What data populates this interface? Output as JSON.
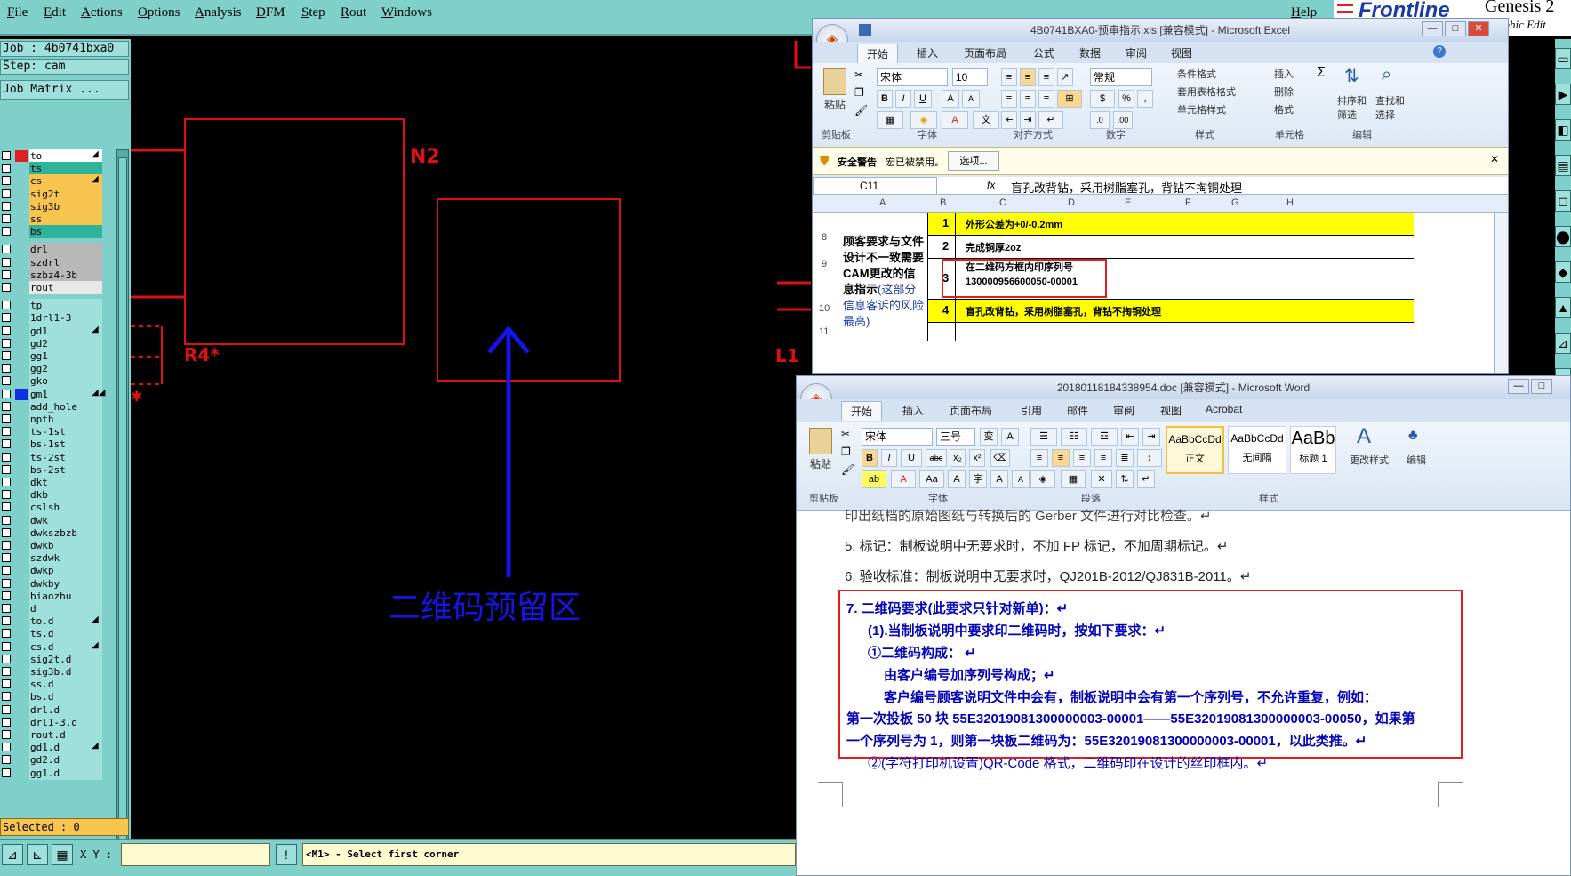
{
  "genesis": {
    "menu": [
      "File",
      "Edit",
      "Actions",
      "Options",
      "Analysis",
      "DFM",
      "Step",
      "Rout",
      "Windows"
    ],
    "help": "Help",
    "brand": "Frontline",
    "product": "Genesis 2",
    "product_sub": "raphic Edit",
    "job": "Job  : 4b0741bxa0",
    "step": "Step: cam",
    "matrix": "Job Matrix ...",
    "layers": [
      {
        "name": "to",
        "color": "#ffffff",
        "sw": "#e02020",
        "flag": "◢"
      },
      {
        "name": "ts",
        "color": "#2fb39a",
        "sw": "",
        "flag": ""
      },
      {
        "name": "cs",
        "color": "#f6c44f",
        "sw": "",
        "flag": "◢"
      },
      {
        "name": "sig2t",
        "color": "#f6c44f",
        "sw": "",
        "flag": ""
      },
      {
        "name": "sig3b",
        "color": "#f6c44f",
        "sw": "",
        "flag": ""
      },
      {
        "name": "ss",
        "color": "#f6c44f",
        "sw": "",
        "flag": ""
      },
      {
        "name": "bs",
        "color": "#2fb39a",
        "sw": "",
        "flag": ""
      },
      {
        "name": "",
        "color": "",
        "sw": "",
        "flag": ""
      },
      {
        "name": "drl",
        "color": "#b8b8b8",
        "sw": "",
        "flag": ""
      },
      {
        "name": "szdrl",
        "color": "#b8b8b8",
        "sw": "",
        "flag": ""
      },
      {
        "name": "szbz4-3b",
        "color": "#b8b8b8",
        "sw": "",
        "flag": ""
      },
      {
        "name": "rout",
        "color": "#e8e8e8",
        "sw": "",
        "flag": ""
      },
      {
        "name": "",
        "color": "",
        "sw": "",
        "flag": ""
      },
      {
        "name": "tp",
        "color": "#9fe0dc",
        "sw": "",
        "flag": ""
      },
      {
        "name": "1drl1-3",
        "color": "#9fe0dc",
        "sw": "",
        "flag": ""
      },
      {
        "name": "gd1",
        "color": "#9fe0dc",
        "sw": "",
        "flag": "◢"
      },
      {
        "name": "gd2",
        "color": "#9fe0dc",
        "sw": "",
        "flag": ""
      },
      {
        "name": "gg1",
        "color": "#9fe0dc",
        "sw": "",
        "flag": ""
      },
      {
        "name": "gg2",
        "color": "#9fe0dc",
        "sw": "",
        "flag": ""
      },
      {
        "name": "gko",
        "color": "#9fe0dc",
        "sw": "",
        "flag": ""
      },
      {
        "name": "gm1",
        "color": "#9fe0dc",
        "sw": "#1030e0",
        "flag": "◢◢"
      },
      {
        "name": "add_hole",
        "color": "#9fe0dc",
        "sw": "",
        "flag": ""
      },
      {
        "name": "npth",
        "color": "#9fe0dc",
        "sw": "",
        "flag": ""
      },
      {
        "name": "ts-1st",
        "color": "#9fe0dc",
        "sw": "",
        "flag": ""
      },
      {
        "name": "bs-1st",
        "color": "#9fe0dc",
        "sw": "",
        "flag": ""
      },
      {
        "name": "ts-2st",
        "color": "#9fe0dc",
        "sw": "",
        "flag": ""
      },
      {
        "name": "bs-2st",
        "color": "#9fe0dc",
        "sw": "",
        "flag": ""
      },
      {
        "name": "dkt",
        "color": "#9fe0dc",
        "sw": "",
        "flag": ""
      },
      {
        "name": "dkb",
        "color": "#9fe0dc",
        "sw": "",
        "flag": ""
      },
      {
        "name": "cslsh",
        "color": "#9fe0dc",
        "sw": "",
        "flag": ""
      },
      {
        "name": "dwk",
        "color": "#9fe0dc",
        "sw": "",
        "flag": ""
      },
      {
        "name": "dwkszbzb",
        "color": "#9fe0dc",
        "sw": "",
        "flag": ""
      },
      {
        "name": "dwkb",
        "color": "#9fe0dc",
        "sw": "",
        "flag": ""
      },
      {
        "name": "szdwk",
        "color": "#9fe0dc",
        "sw": "",
        "flag": ""
      },
      {
        "name": "dwkp",
        "color": "#9fe0dc",
        "sw": "",
        "flag": ""
      },
      {
        "name": "dwkby",
        "color": "#9fe0dc",
        "sw": "",
        "flag": ""
      },
      {
        "name": "biaozhu",
        "color": "#9fe0dc",
        "sw": "",
        "flag": ""
      },
      {
        "name": "d",
        "color": "#9fe0dc",
        "sw": "",
        "flag": ""
      },
      {
        "name": "to.d",
        "color": "#9fe0dc",
        "sw": "",
        "flag": "◢"
      },
      {
        "name": "ts.d",
        "color": "#9fe0dc",
        "sw": "",
        "flag": ""
      },
      {
        "name": "cs.d",
        "color": "#9fe0dc",
        "sw": "",
        "flag": "◢"
      },
      {
        "name": "sig2t.d",
        "color": "#9fe0dc",
        "sw": "",
        "flag": ""
      },
      {
        "name": "sig3b.d",
        "color": "#9fe0dc",
        "sw": "",
        "flag": ""
      },
      {
        "name": "ss.d",
        "color": "#9fe0dc",
        "sw": "",
        "flag": ""
      },
      {
        "name": "bs.d",
        "color": "#9fe0dc",
        "sw": "",
        "flag": ""
      },
      {
        "name": "drl.d",
        "color": "#9fe0dc",
        "sw": "",
        "flag": ""
      },
      {
        "name": "drl1-3.d",
        "color": "#9fe0dc",
        "sw": "",
        "flag": ""
      },
      {
        "name": "rout.d",
        "color": "#9fe0dc",
        "sw": "",
        "flag": ""
      },
      {
        "name": "gd1.d",
        "color": "#9fe0dc",
        "sw": "",
        "flag": "◢"
      },
      {
        "name": "gd2.d",
        "color": "#9fe0dc",
        "sw": "",
        "flag": ""
      },
      {
        "name": "gg1.d",
        "color": "#9fe0dc",
        "sw": "",
        "flag": ""
      }
    ],
    "selected": "Selected : 0",
    "xy_label": "X Y :",
    "xy_value": "",
    "prompt": "<M1> - Select first corner",
    "canvas": {
      "n2": "N2",
      "r4": "R4*",
      "l1": "L1",
      "qr_area": "二维码预留区"
    }
  },
  "excel": {
    "title": "4B0741BXA0-预审指示.xls  [兼容模式] - Microsoft Excel",
    "tabs": [
      "开始",
      "插入",
      "页面布局",
      "公式",
      "数据",
      "审阅",
      "视图"
    ],
    "font": "宋体",
    "size": "10",
    "number_format": "常规",
    "groups": [
      "剪贴板",
      "字体",
      "对齐方式",
      "数字",
      "样式",
      "单元格",
      "编辑"
    ],
    "paste": "粘贴",
    "styles": [
      "条件格式",
      "套用表格格式",
      "单元格样式"
    ],
    "cells_btns": [
      "插入",
      "删除",
      "格式"
    ],
    "edit_btns": [
      "排序和筛选",
      "查找和选择"
    ],
    "security_warning": "安全警告",
    "macro_disabled": "宏已被禁用。",
    "options_btn": "选项...",
    "name_box": "C11",
    "fx": "fx",
    "formula": "盲孔改背钻，采用树脂塞孔，背钻不掏铜处理",
    "columns": [
      "A",
      "B",
      "C",
      "D",
      "E",
      "F",
      "G",
      "H"
    ],
    "rows": [
      "8",
      "9",
      "10",
      "11"
    ],
    "a_text": "顾客要求与文件设计不一致需要CAM更改的信息指示",
    "a_text_blue": "(这部分信息客诉的风险最高)",
    "items": [
      {
        "n": "1",
        "text": "外形公差为+0/-0.2mm",
        "hl": true
      },
      {
        "n": "2",
        "text": "完成铜厚2oz",
        "hl": false
      },
      {
        "n": "3",
        "text": "在二维码方框内印序列号\n130000956600050-00001",
        "hl": false
      },
      {
        "n": "4",
        "text": "盲孔改背钻，采用树脂塞孔，背钻不掏铜处理",
        "hl": true
      }
    ]
  },
  "word": {
    "title": "20180118184338954.doc [兼容模式] - Microsoft Word",
    "tabs": [
      "开始",
      "插入",
      "页面布局",
      "引用",
      "邮件",
      "审阅",
      "视图",
      "Acrobat"
    ],
    "font": "宋体",
    "size": "三号",
    "paste": "粘贴",
    "groups": [
      "剪贴板",
      "字体",
      "段落",
      "样式"
    ],
    "styles": [
      {
        "preview": "AaBbCcDd",
        "name": "正文"
      },
      {
        "preview": "AaBbCcDd",
        "name": "无间隔"
      },
      {
        "preview": "AaBb",
        "name": "标题 1"
      }
    ],
    "change_styles": "更改样式",
    "edit": "编辑",
    "lines": [
      "印出纸档的原始图纸与转换后的 Gerber 文件进行对比检查。↵",
      "5. 标记：制板说明中无要求时，不加 FP 标记，不加周期标记。↵",
      "6. 验收标准：制板说明中无要求时，QJ201B-2012/QJ831B-2011。↵"
    ],
    "qr": [
      "7.  二维码要求(此要求只针对新单)：↵",
      "(1).当制板说明中要求印二维码时，按如下要求：↵",
      "①二维码构成：  ↵",
      "由客户编号加序列号构成；↵",
      "客户编号顾客说明文件中会有，制板说明中会有第一个序列号，不允许重复，例如：",
      "第一次投板 50 块 55E32019081300000003-00001——55E32019081300000003-00050，如果第",
      "一个序列号为 1，则第一块板二维码为：55E32019081300000003-00001，以此类推。↵"
    ],
    "qr_after": "②(字符打印机设置)QR-Code 格式，二维码印在设计的丝印框内。↵"
  }
}
